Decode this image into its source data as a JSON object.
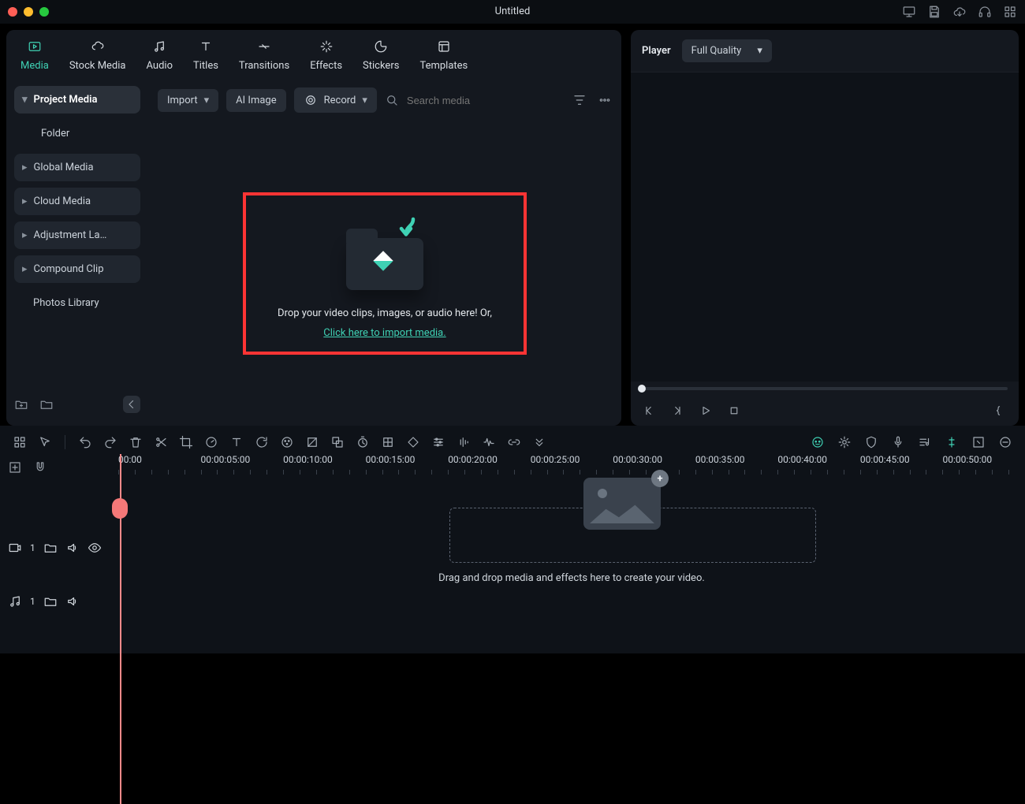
{
  "window": {
    "title": "Untitled"
  },
  "top_icons": [
    "monitor",
    "save",
    "cloud",
    "headphones",
    "grid"
  ],
  "tabs": [
    {
      "id": "media",
      "label": "Media",
      "active": true
    },
    {
      "id": "stock",
      "label": "Stock Media"
    },
    {
      "id": "audio",
      "label": "Audio"
    },
    {
      "id": "titles",
      "label": "Titles"
    },
    {
      "id": "transitions",
      "label": "Transitions"
    },
    {
      "id": "effects",
      "label": "Effects"
    },
    {
      "id": "stickers",
      "label": "Stickers"
    },
    {
      "id": "templates",
      "label": "Templates"
    }
  ],
  "sidebar": {
    "items": [
      {
        "label": "Project Media",
        "selected": true,
        "caret": "down"
      },
      {
        "label": "Folder",
        "plain": true
      },
      {
        "label": "Global Media",
        "caret": "right"
      },
      {
        "label": "Cloud Media",
        "caret": "right"
      },
      {
        "label": "Adjustment La…",
        "caret": "right"
      },
      {
        "label": "Compound Clip",
        "caret": "right"
      },
      {
        "label": "Photos Library",
        "plain": true
      }
    ]
  },
  "toolbar": {
    "import": "Import",
    "ai_image": "AI Image",
    "record": "Record",
    "search_placeholder": "Search media"
  },
  "dropzone": {
    "line1": "Drop your video clips, images, or audio here! Or,",
    "link": "Click here to import media."
  },
  "player": {
    "label": "Player",
    "quality": "Full Quality"
  },
  "ruler": {
    "labels": [
      "00:00",
      "00:00:05:00",
      "00:00:10:00",
      "00:00:15:00",
      "00:00:20:00",
      "00:00:25:00",
      "00:00:30:00",
      "00:00:35:00",
      "00:00:40:00",
      "00:00:45:00",
      "00:00:50:00"
    ]
  },
  "tracks": {
    "video_num": "1",
    "audio_num": "1"
  },
  "timeline": {
    "drop_msg": "Drag and drop media and effects here to create your video."
  }
}
